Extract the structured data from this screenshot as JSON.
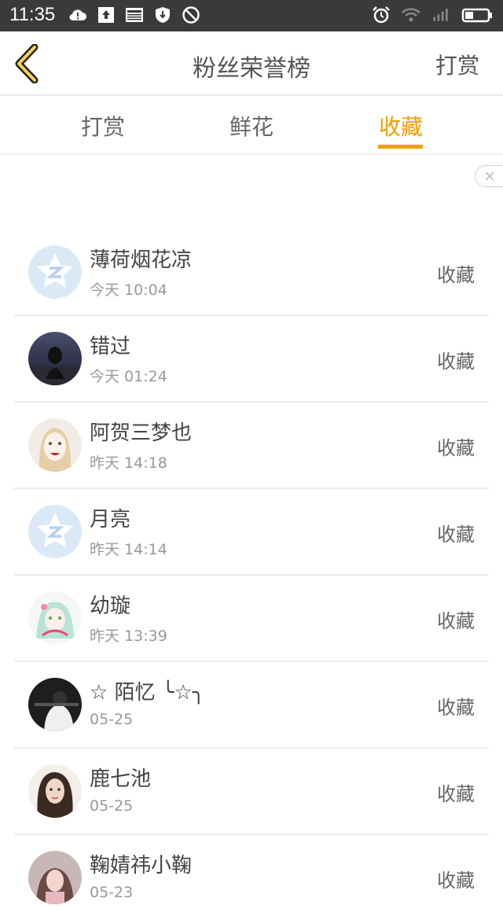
{
  "status_bar": {
    "time": "11:35"
  },
  "header": {
    "title": "粉丝荣誉榜",
    "action": "打赏"
  },
  "tabs": [
    {
      "label": "打赏",
      "active": false
    },
    {
      "label": "鲜花",
      "active": false
    },
    {
      "label": "收藏",
      "active": true
    }
  ],
  "accent_color": "#f0a000",
  "list": [
    {
      "name": "薄荷烟花凉",
      "time": "今天 10:04",
      "action": "收藏"
    },
    {
      "name": "错过",
      "time": "今天 01:24",
      "action": "收藏"
    },
    {
      "name": "阿贺三梦也",
      "time": "昨天 14:18",
      "action": "收藏"
    },
    {
      "name": "月亮",
      "time": "昨天 14:14",
      "action": "收藏"
    },
    {
      "name": "幼璇",
      "time": "昨天 13:39",
      "action": "收藏"
    },
    {
      "name": "☆ 陌忆 ╰☆╮",
      "time": "05-25",
      "action": "收藏"
    },
    {
      "name": "鹿七池",
      "time": "05-25",
      "action": "收藏"
    },
    {
      "name": "鞠婧祎小鞠",
      "time": "05-23",
      "action": "收藏"
    }
  ]
}
